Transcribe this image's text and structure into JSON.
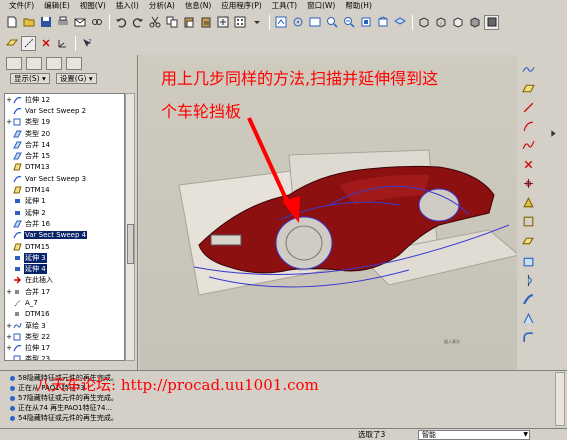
{
  "menu": [
    "文件(F)",
    "编辑(E)",
    "视图(V)",
    "插入(I)",
    "分析(A)",
    "信息(N)",
    "应用程序(P)",
    "工具(T)",
    "窗口(W)",
    "帮助(H)"
  ],
  "left_panel": {
    "show_label": "显示(S) ▾",
    "settings_label": "设置(G) ▾"
  },
  "tree": [
    {
      "toggle": "+",
      "icon": "sweep",
      "label": "拉伸 12"
    },
    {
      "toggle": "",
      "icon": "sweep",
      "label": "Var Sect Sweep 2"
    },
    {
      "toggle": "+",
      "icon": "doc",
      "label": "类型 19"
    },
    {
      "toggle": "",
      "icon": "merge",
      "label": "类型 20"
    },
    {
      "toggle": "",
      "icon": "merge",
      "label": "合并 14"
    },
    {
      "toggle": "",
      "icon": "merge",
      "label": "合并 15"
    },
    {
      "toggle": "",
      "icon": "plane",
      "label": "DTM13"
    },
    {
      "toggle": "",
      "icon": "sweep",
      "label": "Var Sect Sweep 3"
    },
    {
      "toggle": "",
      "icon": "plane",
      "label": "DTM14"
    },
    {
      "toggle": "",
      "icon": "ext",
      "label": "延伸 1"
    },
    {
      "toggle": "",
      "icon": "ext",
      "label": "延伸 2"
    },
    {
      "toggle": "",
      "icon": "merge",
      "label": "合并 16"
    },
    {
      "toggle": "",
      "icon": "sweep",
      "label": "Var Sect Sweep 4",
      "selected": true
    },
    {
      "toggle": "",
      "icon": "plane",
      "label": "DTM15"
    },
    {
      "toggle": "",
      "icon": "ext",
      "label": "延伸 3",
      "selected": true
    },
    {
      "toggle": "",
      "icon": "ext",
      "label": "延伸 4",
      "selected": true
    },
    {
      "toggle": "",
      "icon": "insert",
      "label": "在此插入"
    },
    {
      "toggle": "+",
      "icon": "hidden",
      "label": "合并 17"
    },
    {
      "toggle": "",
      "icon": "axis",
      "label": "A_7"
    },
    {
      "toggle": "",
      "icon": "hidden",
      "label": "DTM16"
    },
    {
      "toggle": "+",
      "icon": "sketch",
      "label": "草绘 3"
    },
    {
      "toggle": "+",
      "icon": "doc",
      "label": "类型 22"
    },
    {
      "toggle": "+",
      "icon": "sweep",
      "label": "拉伸 17"
    },
    {
      "toggle": "",
      "icon": "doc",
      "label": "类型 23"
    }
  ],
  "annotation": {
    "line1": "用上几步同样的方法,扫描并延伸得到这",
    "line2": "个车轮挡板"
  },
  "viewport_tag": "插入表头",
  "messages": [
    "58隐藏特征或元件的再生完成。",
    "正在从 PAO1 特征73",
    "57隐藏特征或元件的再生完成。",
    "正在从74 再生PAO1特征74...",
    "54隐藏特征或元件的再生完成。"
  ],
  "watermark": "八天车论坛: http://procad.uu1001.com",
  "status": {
    "selected": "选取了3",
    "filter": "智能"
  },
  "colors": {
    "car_body": "#8c1010",
    "annotation": "#ff0000",
    "selection": "#0a246a",
    "wire": "#3a3ad0"
  }
}
